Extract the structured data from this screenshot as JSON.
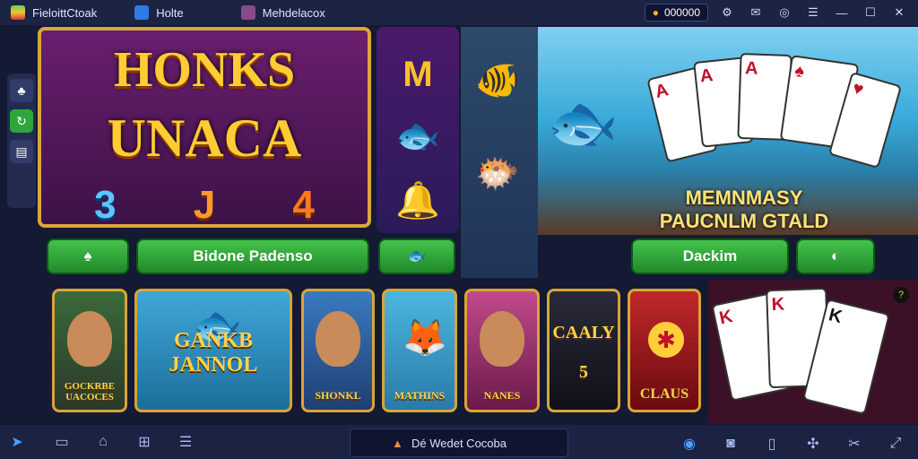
{
  "topbar": {
    "tabs": [
      {
        "label": "FieloittCtoak",
        "icon": "app-logo-icon"
      },
      {
        "label": "Holte",
        "icon": "home-icon"
      },
      {
        "label": "Mehdelacox",
        "icon": "game-tab-icon"
      }
    ],
    "coins": "000000",
    "window_buttons": [
      "settings-icon",
      "notification-icon",
      "help-icon",
      "menu-icon",
      "minimize-icon",
      "maximize-icon",
      "close-icon"
    ]
  },
  "slot_game": {
    "title_line1": "HONKS",
    "title_line2": "UNACA",
    "reel_values": [
      "3",
      "J",
      "4"
    ]
  },
  "slot_buttons": {
    "left_icon": "leaf-icon",
    "main_label": "Bidone Padenso",
    "right_icon": "fish-icon"
  },
  "featured": {
    "title_line1": "MEMNMASY",
    "title_line2": "PAUCNLM GTALD",
    "button_label": "Dackim",
    "side_icon": "share-icon"
  },
  "thumbnails": [
    {
      "label": "GOCKRBE UACOCES"
    },
    {
      "label": "GANKB JANNOL"
    },
    {
      "label": "SHONKL"
    },
    {
      "label": "MATHINS"
    },
    {
      "label": "NANES"
    },
    {
      "label": "CAALY 5"
    },
    {
      "label": "CLAUS"
    }
  ],
  "bottombar": {
    "search_label": "Dé Wedet Cocoba"
  },
  "colors": {
    "accent_gold": "#d9a73a",
    "button_green": "#2fa63a",
    "frame_bg": "#1c2444"
  }
}
